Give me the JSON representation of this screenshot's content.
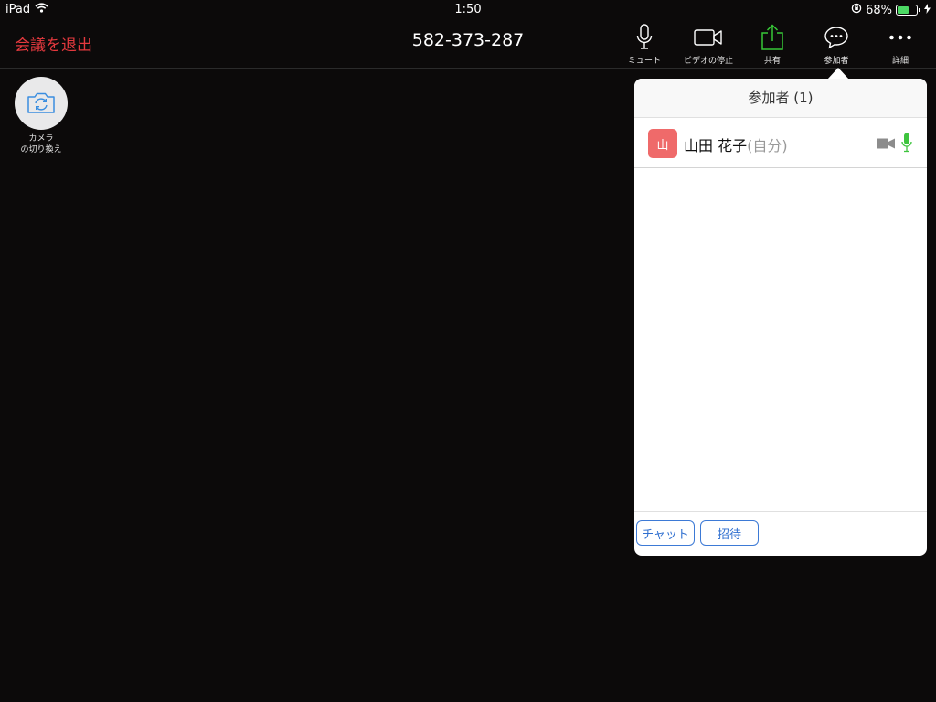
{
  "status_bar": {
    "device": "iPad",
    "time": "1:50",
    "battery": "68%",
    "battery_level": 0.68
  },
  "meeting": {
    "leave_label": "会議を退出",
    "meeting_id": "582-373-287"
  },
  "toolbar": {
    "mute_label": "ミュート",
    "stop_video_label": "ビデオの停止",
    "share_label": "共有",
    "participants_label": "参加者",
    "more_label": "詳細"
  },
  "camera_switch": {
    "label_line1": "カメラ",
    "label_line2": "の切り換え"
  },
  "participants_panel": {
    "title": "参加者 (1)",
    "participants": [
      {
        "avatar_text": "山",
        "name": "山田 花子",
        "self_tag": "(自分)",
        "avatar_color": "#ef6a6a"
      }
    ],
    "chat_button": "チャット",
    "invite_button": "招待"
  },
  "colors": {
    "leave": "#e5393e",
    "share_icon": "#37c837",
    "mic_active": "#3ec43e",
    "button_accent": "#2f6fd0"
  },
  "icons": [
    "wifi-icon",
    "rotation-lock-icon",
    "battery-icon",
    "charging-icon",
    "microphone-icon",
    "video-camera-icon",
    "share-icon",
    "chat-bubble-icon",
    "more-icon",
    "camera-switch-icon"
  ]
}
